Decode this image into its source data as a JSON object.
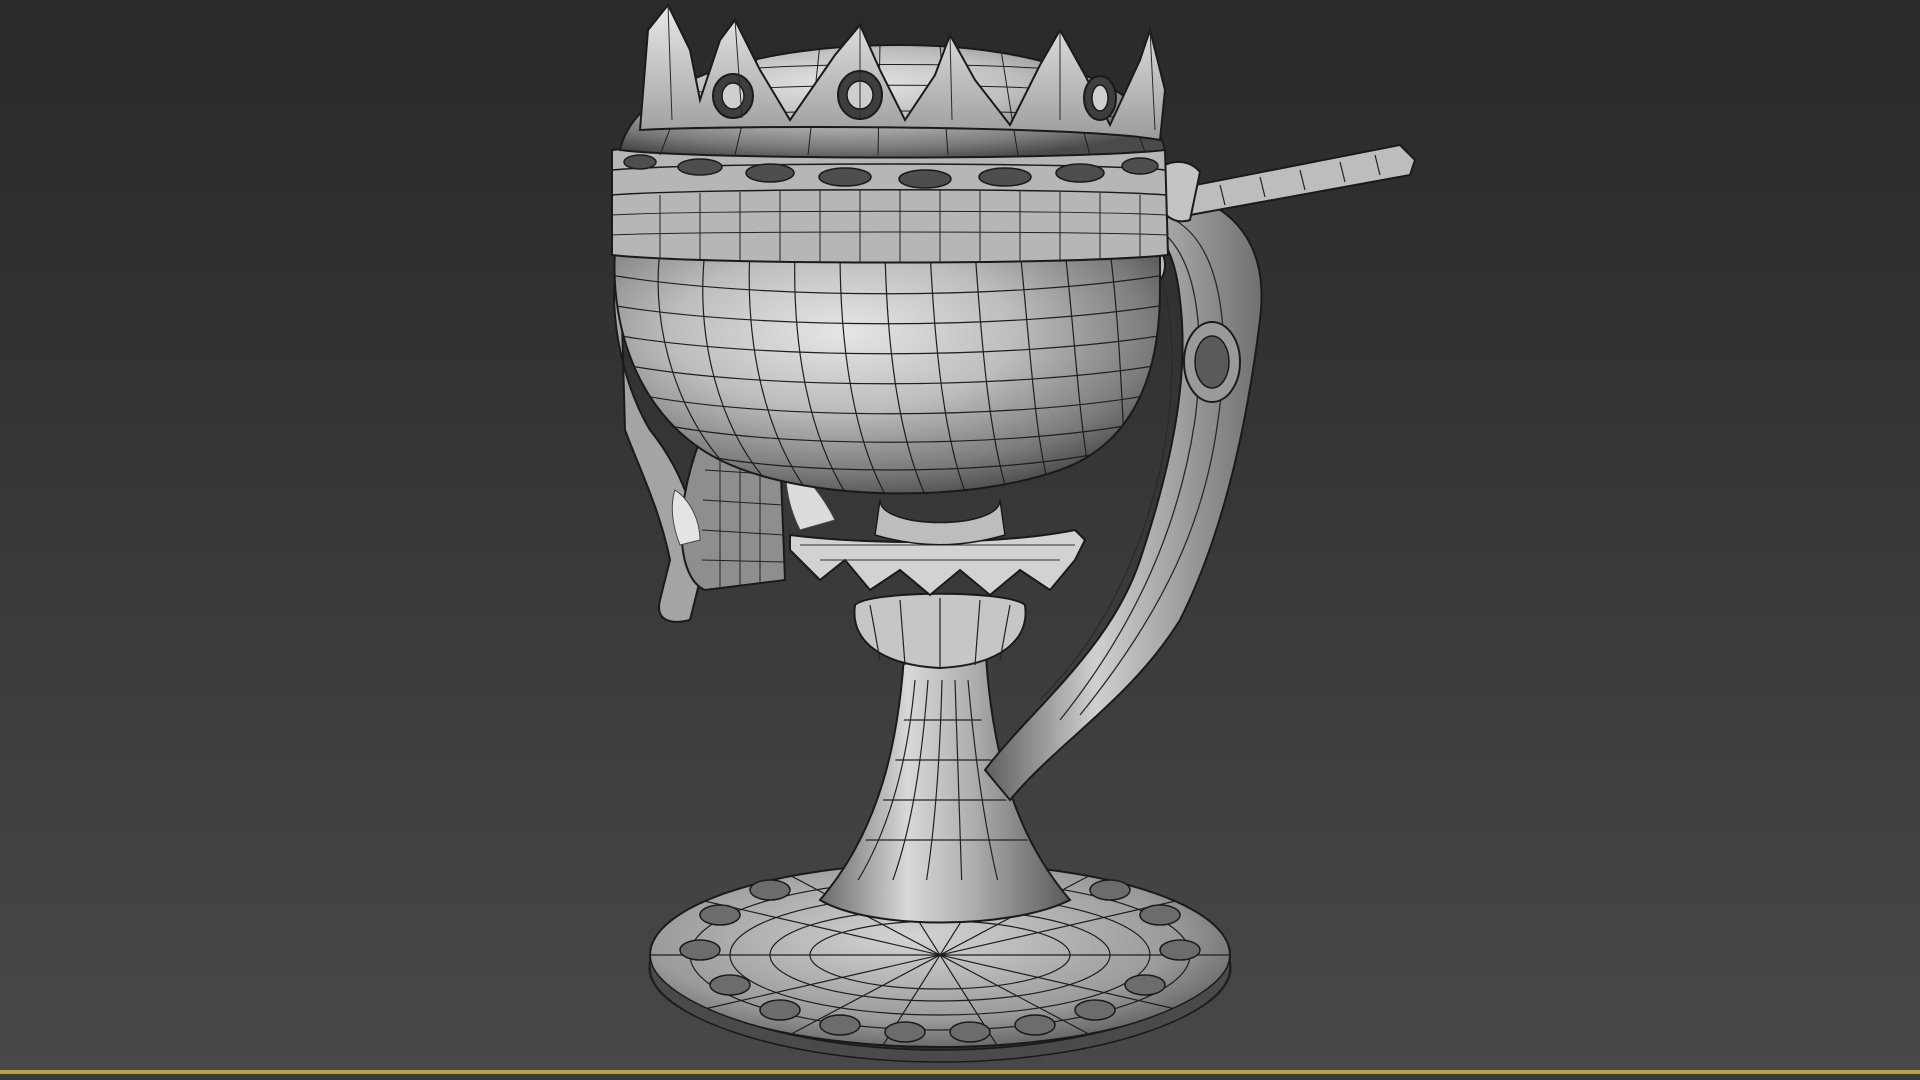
{
  "viewport": {
    "view_name": "",
    "shading_mode": "",
    "border_color": "#b9a24a",
    "background_top": "#2a2a2a",
    "background_bottom": "#484848"
  },
  "model": {
    "icon": "chalice-oil-lamp-wireframe"
  }
}
